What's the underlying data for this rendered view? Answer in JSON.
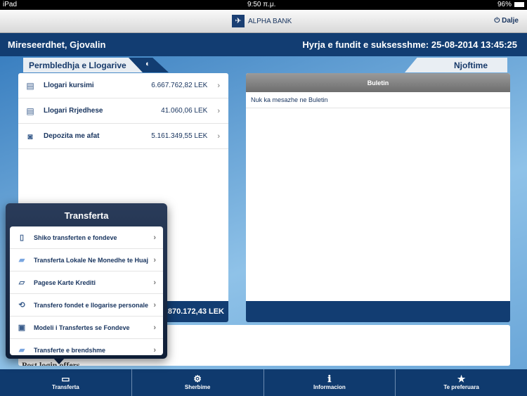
{
  "status": {
    "device": "iPad",
    "time": "9:50 π.μ.",
    "battery": "96%"
  },
  "header": {
    "bank": "ALPHA BANK",
    "logout": "Dalje"
  },
  "welcome": "Mireseerdhet, Gjovalin",
  "last_login": "Hyrja e fundit e suksesshme: 25-08-2014 13:45:25",
  "accounts": {
    "tab": "Permbledhja e Llogarive",
    "items": [
      {
        "label": "Llogari kursimi",
        "amount": "6.667.762,82 LEK"
      },
      {
        "label": "Llogari Rrjedhese",
        "amount": "41.060,06 LEK"
      },
      {
        "label": "Depozita me afat",
        "amount": "5.161.349,55 LEK"
      }
    ],
    "total": "11.870.172,43 LEK"
  },
  "notices": {
    "tab": "Njoftime",
    "header": "Buletin",
    "empty": "Nuk ka mesazhe ne Buletin"
  },
  "offers": "Post login offers",
  "popover": {
    "title": "Transferta",
    "items": [
      "Shiko transferten e  fondeve",
      "Transferta Lokale Ne Monedhe te Huaj",
      "Pagese Karte Krediti",
      "Transfero fondet e llogarise personale",
      "Modeli i Transfertes se Fondeve",
      "Transferte e brendshme"
    ]
  },
  "tabbar": [
    "Transferta",
    "Sherbime",
    "Informacion",
    "Te preferuara"
  ]
}
